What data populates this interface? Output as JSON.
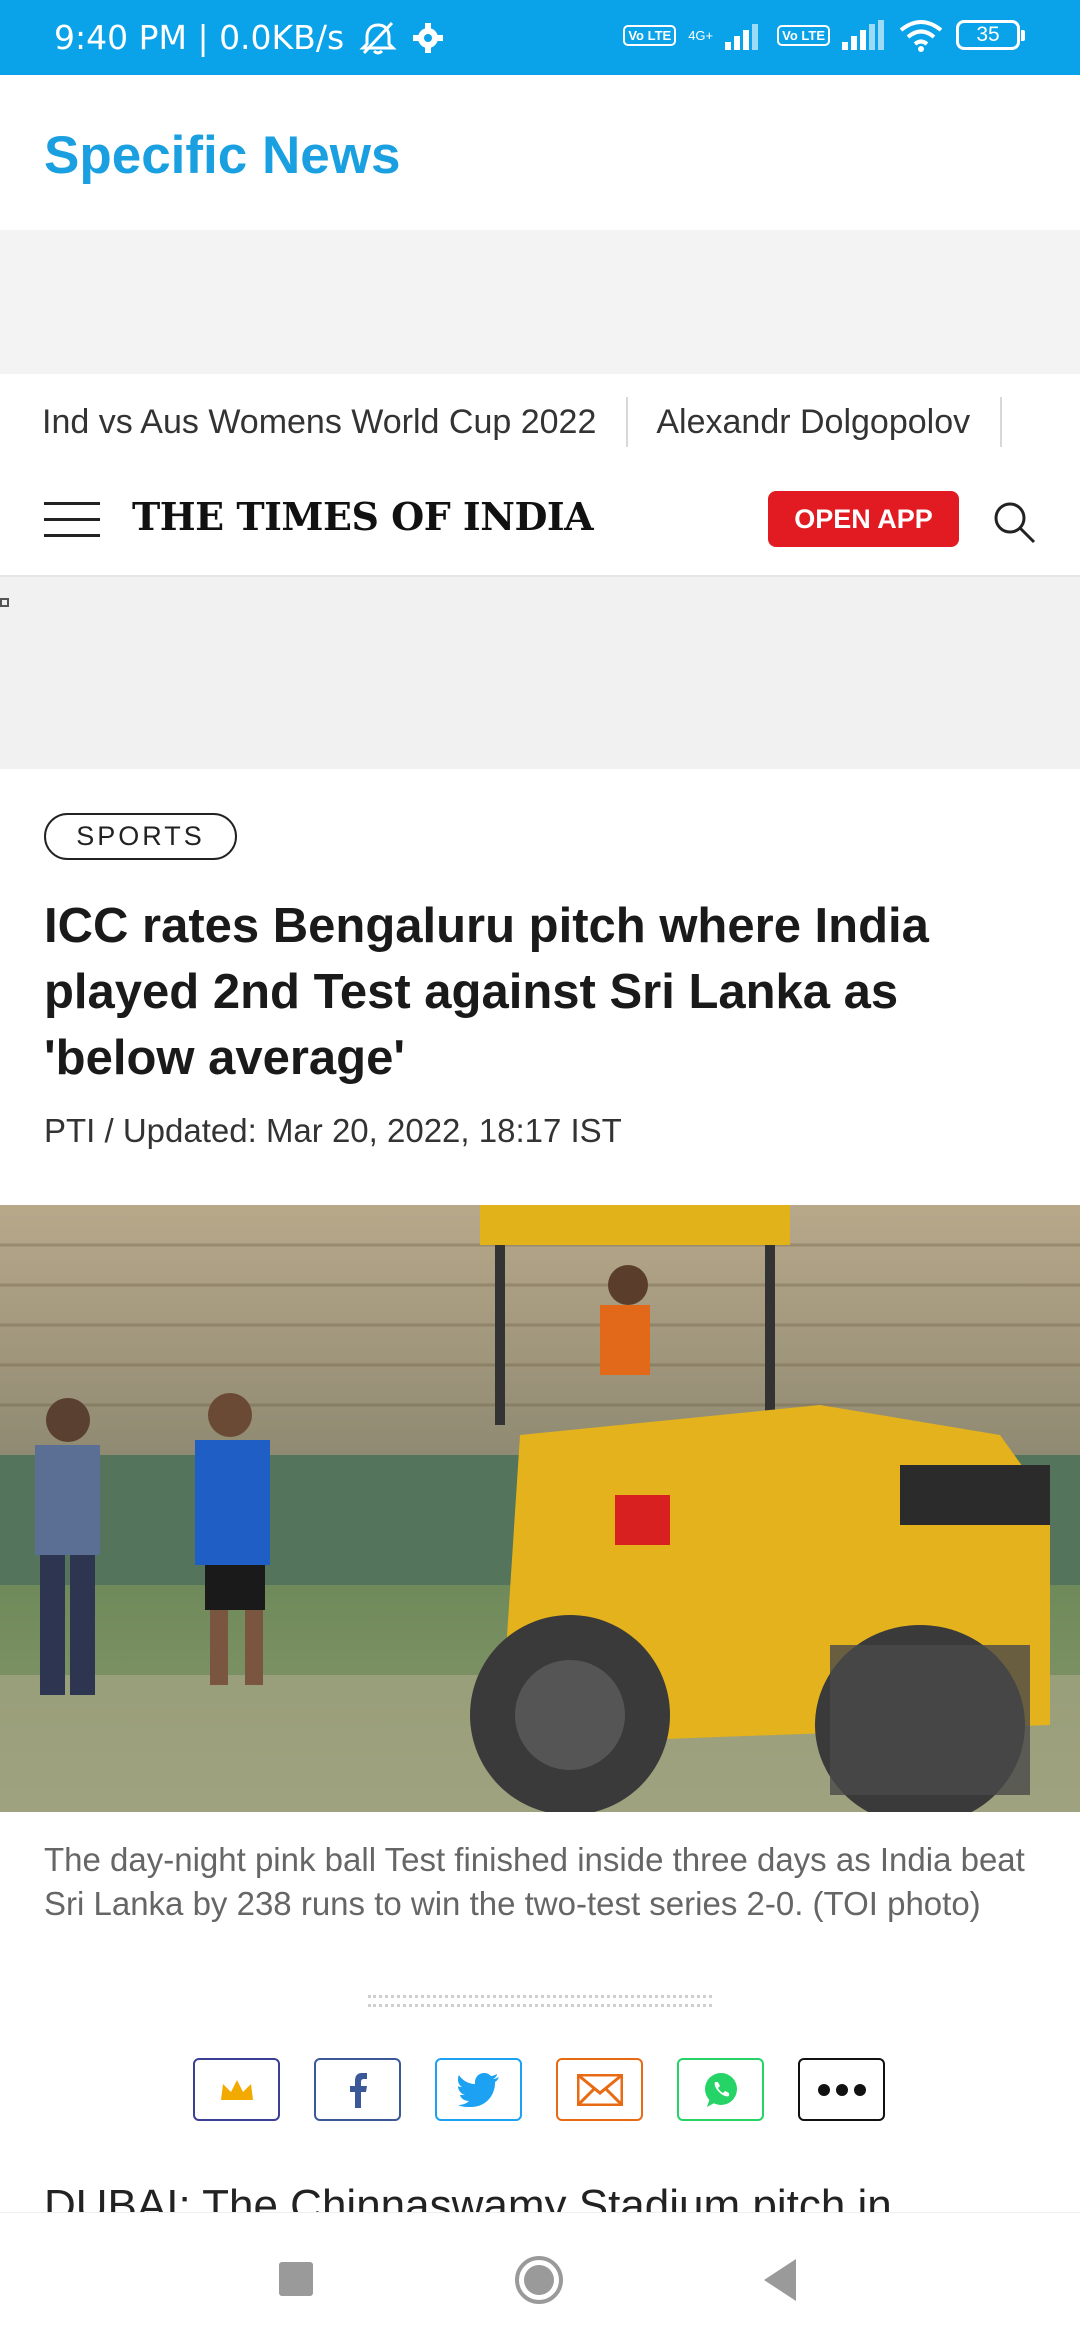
{
  "status_bar": {
    "time": "9:40 PM | 0.0KB/s",
    "lte1": "Vo LTE",
    "network": "4G+",
    "lte2": "Vo LTE",
    "battery": "35"
  },
  "app": {
    "title": "Specific News"
  },
  "trending": [
    "Ind vs Aus Womens World Cup 2022",
    "Alexandr Dolgopolov"
  ],
  "site_header": {
    "logo": "THE TIMES OF INDIA",
    "open_app": "OPEN APP"
  },
  "article": {
    "section": "SPORTS",
    "headline": "ICC rates Bengaluru pitch where India played 2nd Test against Sri Lanka as 'below average'",
    "byline": "PTI / Updated: Mar 20, 2022, 18:17 IST",
    "caption": "The day-night pink ball Test finished inside three days as India beat Sri Lanka by 238 runs to win the two-test series 2-0. (TOI photo)",
    "body_start": "DUBAI: The Chinnaswamy Stadium pitch in"
  },
  "share_icons": [
    "crown-icon",
    "facebook-icon",
    "twitter-icon",
    "email-icon",
    "whatsapp-icon",
    "more-icon"
  ],
  "colors": {
    "status_bar": "#0aa2e8",
    "app_title": "#1aa0e0",
    "open_app": "#e21b22",
    "crown": "#3b3f95",
    "facebook": "#3b5998",
    "twitter": "#1da1f2",
    "email": "#e86a12",
    "whatsapp": "#25d366"
  }
}
